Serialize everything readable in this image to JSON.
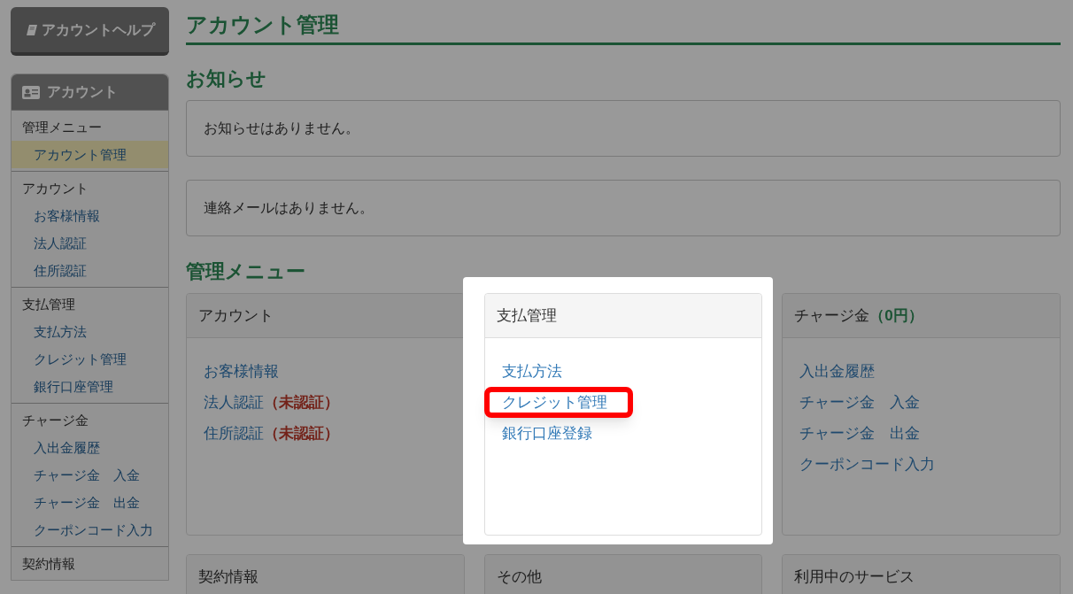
{
  "help_button": {
    "label": "アカウントヘルプ"
  },
  "sidebar": {
    "title": "アカウント",
    "groups": [
      {
        "label": "管理メニュー",
        "items": [
          {
            "label": "アカウント管理",
            "selected": true
          }
        ]
      },
      {
        "label": "アカウント",
        "items": [
          {
            "label": "お客様情報",
            "selected": false
          },
          {
            "label": "法人認証",
            "selected": false
          },
          {
            "label": "住所認証",
            "selected": false
          }
        ]
      },
      {
        "label": "支払管理",
        "items": [
          {
            "label": "支払方法",
            "selected": false
          },
          {
            "label": "クレジット管理",
            "selected": false
          },
          {
            "label": "銀行口座管理",
            "selected": false
          }
        ]
      },
      {
        "label": "チャージ金",
        "items": [
          {
            "label": "入出金履歴",
            "selected": false
          },
          {
            "label": "チャージ金　入金",
            "selected": false
          },
          {
            "label": "チャージ金　出金",
            "selected": false
          },
          {
            "label": "クーポンコード入力",
            "selected": false
          }
        ]
      },
      {
        "label": "契約情報"
      }
    ]
  },
  "page_title": "アカウント管理",
  "notices": {
    "heading": "お知らせ",
    "messages": [
      "お知らせはありません。",
      "連絡メールはありません。"
    ]
  },
  "menu": {
    "heading": "管理メニュー",
    "cards": [
      {
        "title": "アカウント",
        "links": [
          {
            "label": "お客様情報"
          },
          {
            "label": "法人認証",
            "status": "（未認証）"
          },
          {
            "label": "住所認証",
            "status": "（未認証）"
          }
        ]
      },
      {
        "title": "支払管理",
        "highlighted": true,
        "links": [
          {
            "label": "支払方法"
          },
          {
            "label": "クレジット管理",
            "highlighted": true
          },
          {
            "label": "銀行口座登録"
          }
        ]
      },
      {
        "title": "チャージ金",
        "amount": "（0円）",
        "links": [
          {
            "label": "入出金履歴"
          },
          {
            "label": "チャージ金　入金"
          },
          {
            "label": "チャージ金　出金"
          },
          {
            "label": "クーポンコード入力"
          }
        ]
      },
      {
        "title": "契約情報"
      },
      {
        "title": "その他"
      },
      {
        "title": "利用中のサービス"
      }
    ]
  }
}
